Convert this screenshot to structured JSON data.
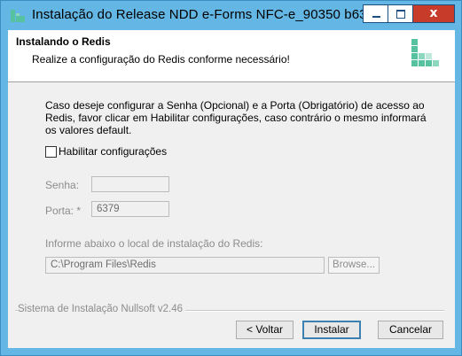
{
  "window": {
    "title": "Instalação do Release NDD e-Forms NFC-e_90350 b63...",
    "minimize_glyph": "",
    "close_glyph": "x"
  },
  "header": {
    "title": "Instalando o Redis",
    "subtitle": "Realize a configuração do Redis conforme necessário!"
  },
  "body": {
    "description": "Caso deseje configurar a Senha (Opcional) e a Porta (Obrigatório) de acesso ao Redis, favor clicar em Habilitar configurações, caso contrário o mesmo informará os valores default.",
    "enable_checkbox": {
      "label": "Habilitar configurações",
      "checked": false
    },
    "password": {
      "label": "Senha:",
      "value": ""
    },
    "port": {
      "label": "Porta: *",
      "value": "6379"
    },
    "install_location": {
      "label": "Informe abaixo o local de instalação do Redis:",
      "value": "C:\\Program Files\\Redis",
      "browse_label": "Browse..."
    }
  },
  "footer": {
    "branding": "Sistema de Instalação Nullsoft v2.46",
    "back_label": "< Voltar",
    "install_label": "Instalar",
    "cancel_label": "Cancelar"
  },
  "colors": {
    "titlebar": "#64b7e4",
    "close_button": "#c73b2b",
    "logo_green": "#56c2a0"
  }
}
